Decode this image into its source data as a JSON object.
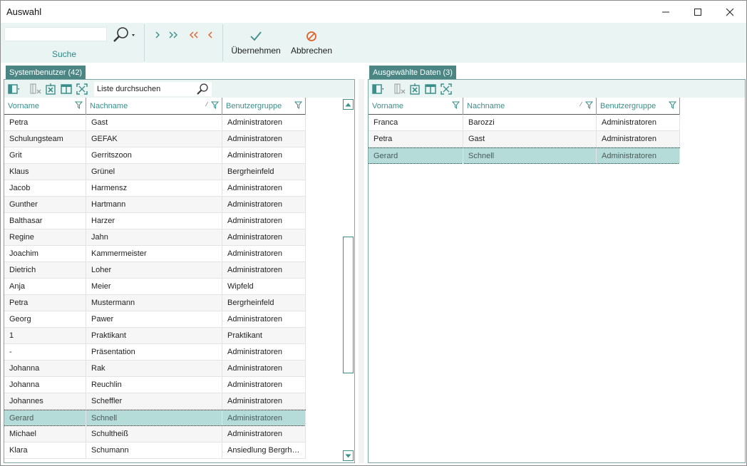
{
  "window": {
    "title": "Auswahl"
  },
  "ribbon": {
    "search_caption": "Suche",
    "apply_label": "Übernehmen",
    "cancel_label": "Abbrechen"
  },
  "left_panel": {
    "tab": "Systembenutzer (42)",
    "search_placeholder": "Liste durchsuchen",
    "columns": [
      "Vorname",
      "Nachname",
      "Benutzergruppe"
    ],
    "rows": [
      [
        "Petra",
        "Gast",
        "Administratoren"
      ],
      [
        "Schulungsteam",
        "GEFAK",
        "Administratoren"
      ],
      [
        "Grit",
        "Gerritszoon",
        "Administratoren"
      ],
      [
        "Klaus",
        "Grünel",
        "Bergrheinfeld"
      ],
      [
        "Jacob",
        "Harmensz",
        "Administratoren"
      ],
      [
        "Gunther",
        "Hartmann",
        "Administratoren"
      ],
      [
        "Balthasar",
        "Harzer",
        "Administratoren"
      ],
      [
        "Regine",
        "Jahn",
        "Administratoren"
      ],
      [
        "Joachim",
        "Kammermeister",
        "Administratoren"
      ],
      [
        "Dietrich",
        "Loher",
        "Administratoren"
      ],
      [
        "Anja",
        "Meier",
        "Wipfeld"
      ],
      [
        "Petra",
        "Mustermann",
        "Bergrheinfeld"
      ],
      [
        "Georg",
        "Pawer",
        "Administratoren"
      ],
      [
        "1",
        "Praktikant",
        "Praktikant"
      ],
      [
        "-",
        "Präsentation",
        "Administratoren"
      ],
      [
        "Johanna",
        "Rak",
        "Administratoren"
      ],
      [
        "Johanna",
        "Reuchlin",
        "Administratoren"
      ],
      [
        "Johannes",
        "Scheffler",
        "Administratoren"
      ],
      [
        "Gerard",
        "Schnell",
        "Administratoren"
      ],
      [
        "Michael",
        "Schultheiß",
        "Administratoren"
      ],
      [
        "Klara",
        "Schumann",
        "Ansiedlung Bergrh…"
      ]
    ],
    "selected_row": 18
  },
  "right_panel": {
    "tab": "Ausgewählte Daten (3)",
    "columns": [
      "Vorname",
      "Nachname",
      "Benutzergruppe"
    ],
    "rows": [
      [
        "Franca",
        "Barozzi",
        "Administratoren"
      ],
      [
        "Petra",
        "Gast",
        "Administratoren"
      ],
      [
        "Gerard",
        "Schnell",
        "Administratoren"
      ]
    ],
    "selected_row": 2
  },
  "colors": {
    "accent": "#3b8e8a",
    "tab": "#4b8684",
    "ribbon": "#e9f4f3",
    "selection": "#b5dcd8",
    "cancel": "#e0622a"
  },
  "icons": [
    "search-icon",
    "dropdown-arrow-icon",
    "add-one-icon",
    "add-all-icon",
    "remove-all-icon",
    "remove-one-icon",
    "checkmark-icon",
    "cancel-icon",
    "column-chooser-icon",
    "clear-filter-icon",
    "export-excel-icon",
    "layout-icon",
    "fit-columns-icon",
    "filter-icon",
    "sort-ascending-icon"
  ]
}
